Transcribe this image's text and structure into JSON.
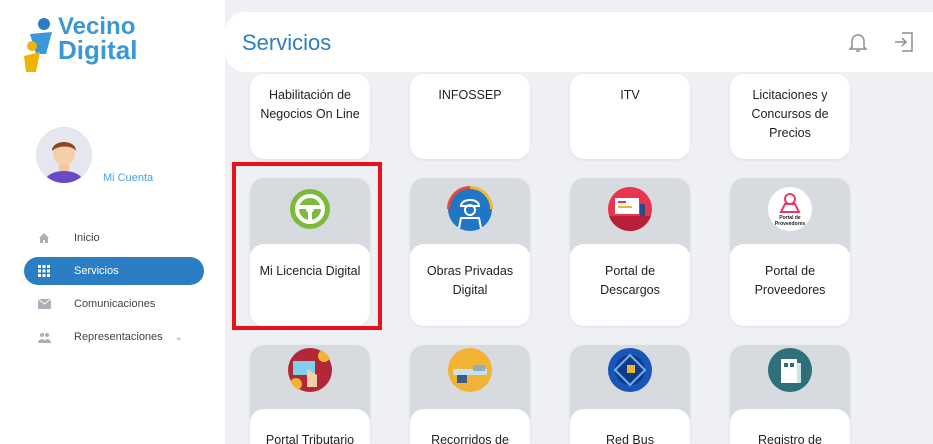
{
  "brand": {
    "line1": "Vecino",
    "line2": "Digital"
  },
  "account": {
    "label": "Mi Cuenta"
  },
  "nav": [
    {
      "label": "Inicio",
      "icon": "home-icon"
    },
    {
      "label": "Servicios",
      "icon": "grid-icon",
      "active": true
    },
    {
      "label": "Comunicaciones",
      "icon": "mail-icon"
    },
    {
      "label": "Representaciones",
      "icon": "people-icon"
    }
  ],
  "header": {
    "title": "Servicios"
  },
  "cards_row1": [
    {
      "label": "Habilitación de Negocios On Line"
    },
    {
      "label": "INFOSSEP"
    },
    {
      "label": "ITV"
    },
    {
      "label": "Licitaciones y Concursos de Precios"
    }
  ],
  "cards_row2": [
    {
      "label": "Mi Licencia Digital",
      "icon": "steering-wheel-icon"
    },
    {
      "label": "Obras Privadas Digital",
      "icon": "worker-icon"
    },
    {
      "label": "Portal de Descargos",
      "icon": "presentation-icon"
    },
    {
      "label": "Portal de Proveedores",
      "icon": "providers-logo-icon",
      "logo_text": "Portal de Proveedores"
    }
  ],
  "cards_row3": [
    {
      "label": "Portal Tributario",
      "icon": "tax-coins-icon"
    },
    {
      "label": "Recorridos de",
      "icon": "bus-route-icon"
    },
    {
      "label": "Red Bus",
      "icon": "red-bus-icon"
    },
    {
      "label": "Registro de",
      "icon": "building-icon"
    }
  ],
  "colors": {
    "accent": "#2b7ec4",
    "highlight": "#e8101a"
  }
}
